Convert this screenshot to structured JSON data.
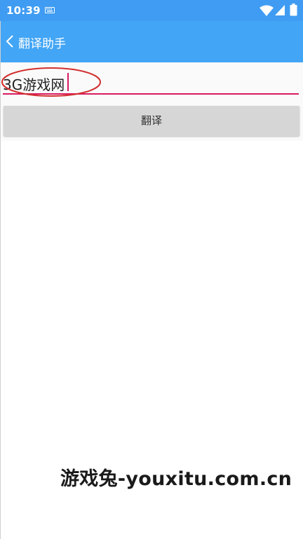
{
  "status_bar": {
    "time": "10:39",
    "background": "#3f9cf2",
    "icons": [
      "keyboard-icon",
      "wifi-icon",
      "signal-icon",
      "battery-icon"
    ]
  },
  "app_bar": {
    "title": "翻译助手",
    "background": "#42a5f5",
    "back_icon": "chevron-left-icon"
  },
  "form": {
    "input_value": "3G游戏网",
    "underline_color": "#d81b60",
    "translate_label": "翻译",
    "annotation_color": "#d32f2f"
  },
  "watermark": {
    "text": "游戏兔-youxitu.com.cn"
  }
}
